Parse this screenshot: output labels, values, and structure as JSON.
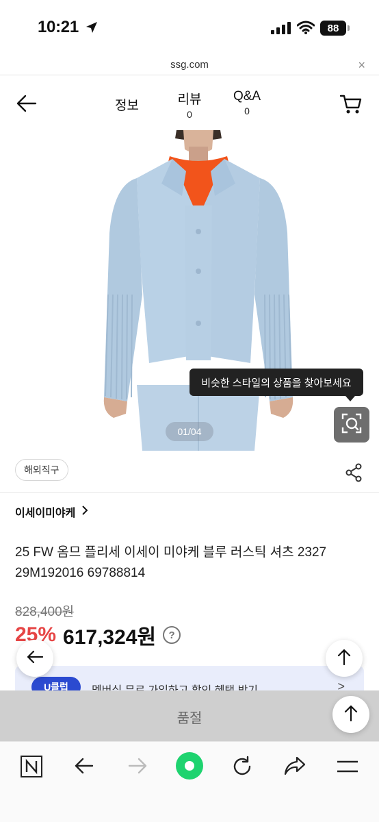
{
  "status_bar": {
    "time": "10:21",
    "battery": "88"
  },
  "url_bar": {
    "domain": "ssg.com",
    "close": "×"
  },
  "header": {
    "tabs": [
      {
        "label": "정보"
      },
      {
        "label": "리뷰",
        "count": "0"
      },
      {
        "label": "Q&A",
        "count": "0"
      }
    ]
  },
  "gallery": {
    "page_indicator": "01/04",
    "tooltip": "비슷한 스타일의 상품을 찾아보세요"
  },
  "product": {
    "tag": "해외직구",
    "brand": "이세이미야케",
    "title": "25 FW 옴므 플리세 이세이 미야케 블루 러스틱 셔츠 2327 29M192016 69788814",
    "original_price": "828,400원",
    "discount": "25%",
    "sale_price": "617,324원",
    "help": "?"
  },
  "coupon": {
    "badge": "U클럽",
    "text": "멤버십 무료 가입하고 할인 혜택 받기",
    "chevron": ">"
  },
  "option_bar": {
    "label": "품절"
  },
  "colors": {
    "discount": "#e64545",
    "option_bar": "#cfcfcf",
    "green_button": "#1ed36f",
    "shirt": "#b9d1e6",
    "turtleneck": "#f2541b"
  },
  "icons": [
    "location-arrow-icon",
    "signal-icon",
    "wifi-icon",
    "battery-icon",
    "back-arrow-icon",
    "cart-icon",
    "visual-search-icon",
    "share-icon",
    "chevron-right-icon",
    "arrow-up-icon",
    "naver-icon",
    "browser-back-icon",
    "browser-forward-icon",
    "green-home-icon",
    "refresh-icon",
    "share-forward-icon",
    "menu-icon"
  ]
}
